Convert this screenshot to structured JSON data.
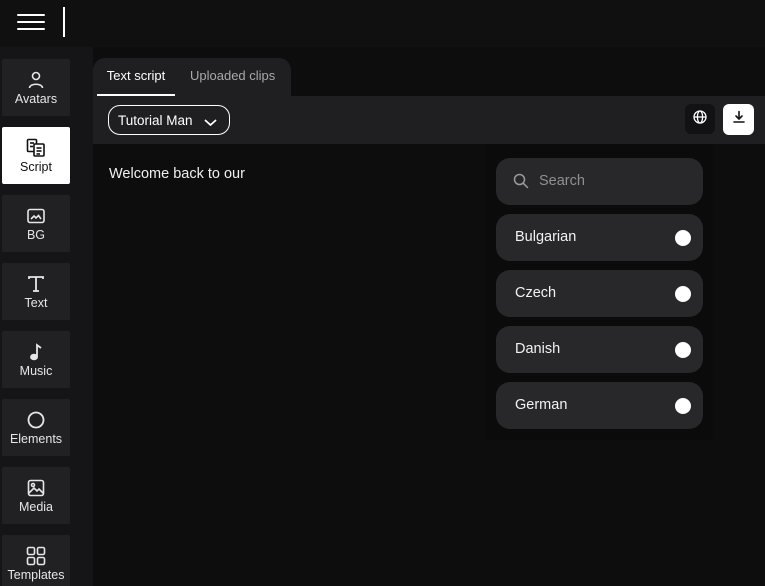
{
  "sidebar": {
    "items": [
      {
        "label": "Avatars",
        "icon": "user-icon"
      },
      {
        "label": "Script",
        "icon": "script-icon",
        "active": true
      },
      {
        "label": "BG",
        "icon": "background-icon"
      },
      {
        "label": "Text",
        "icon": "text-icon"
      },
      {
        "label": "Music",
        "icon": "music-note-icon"
      },
      {
        "label": "Elements",
        "icon": "circle-icon"
      },
      {
        "label": "Media",
        "icon": "image-icon"
      },
      {
        "label": "Templates",
        "icon": "templates-icon"
      }
    ]
  },
  "tabs": [
    {
      "label": "Text script",
      "active": true
    },
    {
      "label": "Uploaded clips",
      "active": false
    }
  ],
  "toolbar": {
    "avatar_select": "Tutorial Man"
  },
  "script": {
    "text": "Welcome back to our"
  },
  "language_dropdown": {
    "search_placeholder": "Search",
    "languages": [
      "Bulgarian",
      "Czech",
      "Danish",
      "German"
    ]
  },
  "colors": {
    "background": "#0d0d0e",
    "panel": "#1f1f22",
    "item": "#28282b",
    "accent": "#ffffff"
  }
}
